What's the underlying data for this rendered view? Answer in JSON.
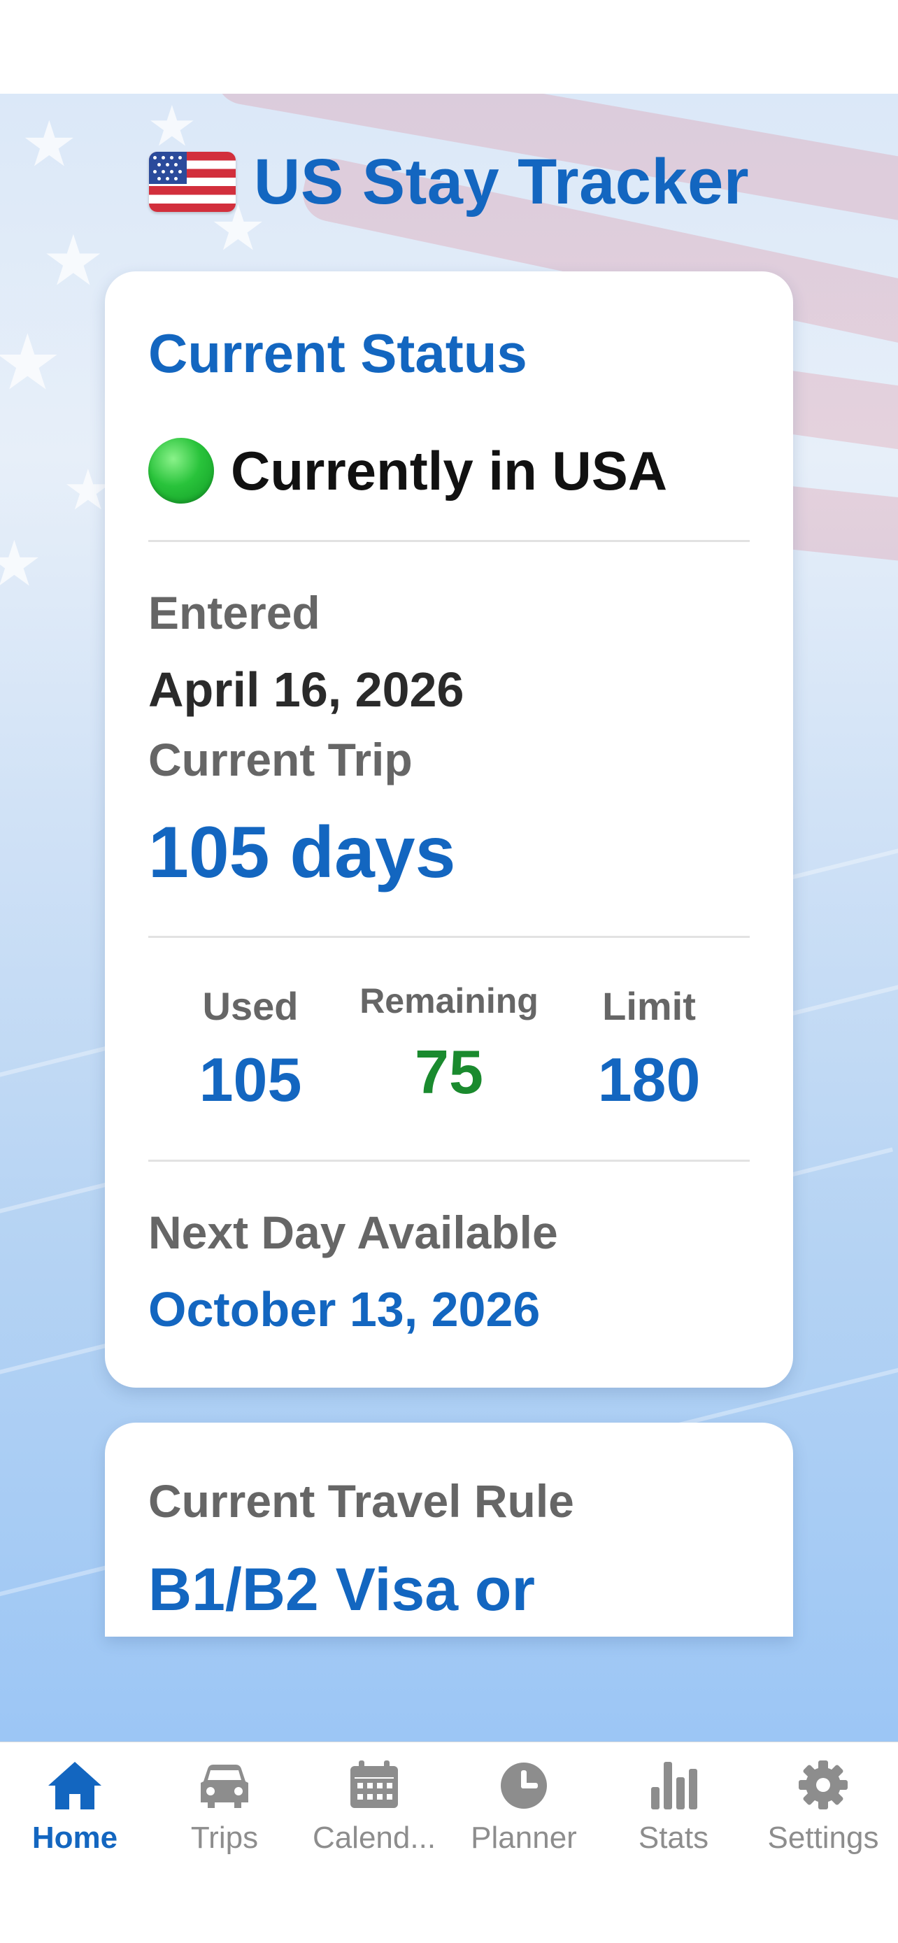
{
  "app": {
    "title": "US Stay Tracker"
  },
  "status_card": {
    "title": "Current Status",
    "status_text": "Currently in USA",
    "entered_label": "Entered",
    "entered_date": "April 16, 2026",
    "current_trip_label": "Current Trip",
    "current_trip_value": "105 days",
    "stats": {
      "used_label": "Used",
      "used_value": "105",
      "remaining_label": "Remaining",
      "remaining_value": "75",
      "limit_label": "Limit",
      "limit_value": "180"
    },
    "next_day_label": "Next Day Available",
    "next_day_value": "October 13, 2026"
  },
  "rule_card": {
    "title": "Current Travel Rule",
    "value": "B1/B2 Visa or"
  },
  "tabbar": {
    "items": [
      {
        "label": "Home",
        "icon": "home-icon",
        "active": true
      },
      {
        "label": "Trips",
        "icon": "car-icon",
        "active": false
      },
      {
        "label": "Calend...",
        "icon": "calendar-icon",
        "active": false
      },
      {
        "label": "Planner",
        "icon": "clock-icon",
        "active": false
      },
      {
        "label": "Stats",
        "icon": "bar-chart-icon",
        "active": false
      },
      {
        "label": "Settings",
        "icon": "gear-icon",
        "active": false
      }
    ]
  },
  "colors": {
    "accent": "#1366c0",
    "remaining": "#1a8a2e",
    "label_gray": "#666666",
    "inactive_tab": "#8d8d8d",
    "status_dot": "#29c33b"
  }
}
